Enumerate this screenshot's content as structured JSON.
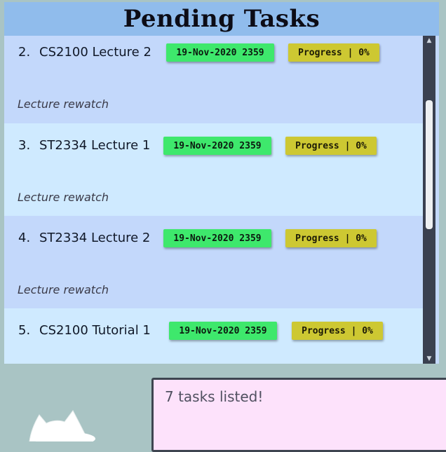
{
  "panel": {
    "title": "Pending Tasks"
  },
  "tasks": [
    {
      "index": "2.",
      "name": "CS2100 Lecture 2",
      "date": "19-Nov-2020 2359",
      "progress": "Progress | 0%",
      "description": "Lecture rewatch"
    },
    {
      "index": "3.",
      "name": "ST2334 Lecture 1",
      "date": "19-Nov-2020 2359",
      "progress": "Progress | 0%",
      "description": "Lecture rewatch"
    },
    {
      "index": "4.",
      "name": "ST2334 Lecture 2",
      "date": "19-Nov-2020 2359",
      "progress": "Progress | 0%",
      "description": "Lecture rewatch"
    },
    {
      "index": "5.",
      "name": "CS2100 Tutorial 1",
      "date": "19-Nov-2020 2359",
      "progress": "Progress | 0%",
      "description": ""
    }
  ],
  "result": {
    "message": "7 tasks listed!"
  },
  "colors": {
    "header": "#90bcec",
    "card_odd": "#c3d8fb",
    "card_even": "#cfeaff",
    "date_badge": "#3ee86c",
    "progress_badge": "#cdc832",
    "result_box": "#fde2fb"
  },
  "icons": {
    "scroll_up": "scroll-up-arrow-icon",
    "scroll_down": "scroll-down-arrow-icon",
    "mascot": "cat-mascot-icon"
  }
}
